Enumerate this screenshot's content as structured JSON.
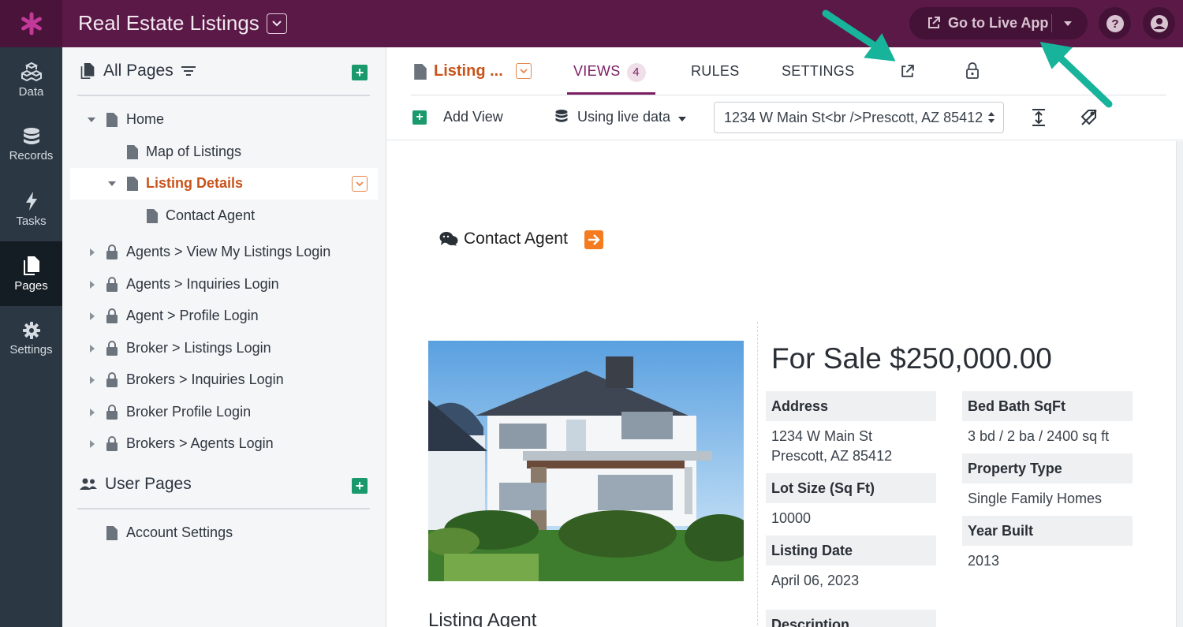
{
  "app": {
    "title": "Real Estate Listings",
    "live_button": "Go to Live App"
  },
  "leftnav": [
    {
      "label": "Data",
      "icon": "data-cubes-icon"
    },
    {
      "label": "Records",
      "icon": "database-icon"
    },
    {
      "label": "Tasks",
      "icon": "bolt-icon"
    },
    {
      "label": "Pages",
      "icon": "pages-icon",
      "active": true
    },
    {
      "label": "Settings",
      "icon": "gear-icon"
    }
  ],
  "sidebar": {
    "all_pages_title": "All Pages",
    "user_pages_title": "User Pages",
    "tree": [
      {
        "label": "Home",
        "level": 1,
        "expanded": true,
        "locked": false
      },
      {
        "label": "Map of Listings",
        "level": 2,
        "locked": false
      },
      {
        "label": "Listing Details",
        "level": 2,
        "expanded": true,
        "selected": true,
        "locked": false
      },
      {
        "label": "Contact Agent",
        "level": 3,
        "locked": false
      },
      {
        "label": "Agents > View My Listings Login",
        "level": 1,
        "locked": true
      },
      {
        "label": "Agents > Inquiries Login",
        "level": 1,
        "locked": true
      },
      {
        "label": "Agent > Profile Login",
        "level": 1,
        "locked": true
      },
      {
        "label": "Broker > Listings Login",
        "level": 1,
        "locked": true
      },
      {
        "label": "Brokers > Inquiries Login",
        "level": 1,
        "locked": true
      },
      {
        "label": "Broker Profile Login",
        "level": 1,
        "locked": true
      },
      {
        "label": "Brokers > Agents Login",
        "level": 1,
        "locked": true
      }
    ],
    "user_pages": [
      {
        "label": "Account Settings"
      }
    ]
  },
  "main": {
    "page_name": "Listing ...",
    "tabs": {
      "views": "VIEWS",
      "views_count": "4",
      "rules": "RULES",
      "settings": "SETTINGS"
    },
    "toolbar": {
      "add_view": "Add View",
      "data_mode": "Using live data",
      "record": "1234 W Main St<br />Prescott, AZ 85412"
    },
    "contact_agent": "Contact Agent",
    "listing": {
      "price": "For Sale $250,000.00",
      "fields_left": [
        {
          "label": "Address",
          "value": "1234 W Main St\nPrescott, AZ 85412"
        },
        {
          "label": "Lot Size (Sq Ft)",
          "value": "10000"
        },
        {
          "label": "Listing Date",
          "value": "April 06, 2023"
        },
        {
          "label": "Description",
          "value": ""
        }
      ],
      "fields_right": [
        {
          "label": "Bed Bath SqFt",
          "value": "3 bd / 2 ba / 2400 sq ft"
        },
        {
          "label": "Property Type",
          "value": "Single Family Homes"
        },
        {
          "label": "Year Built",
          "value": "2013"
        }
      ],
      "listing_agent_heading": "Listing Agent"
    }
  },
  "colors": {
    "topbar": "#5a1946",
    "leftnav": "#2b3743",
    "accent_orange": "#c8531b",
    "accent_purple": "#7b1e64",
    "add_green": "#1a9a6c",
    "annotation_arrow": "#17b39a"
  }
}
